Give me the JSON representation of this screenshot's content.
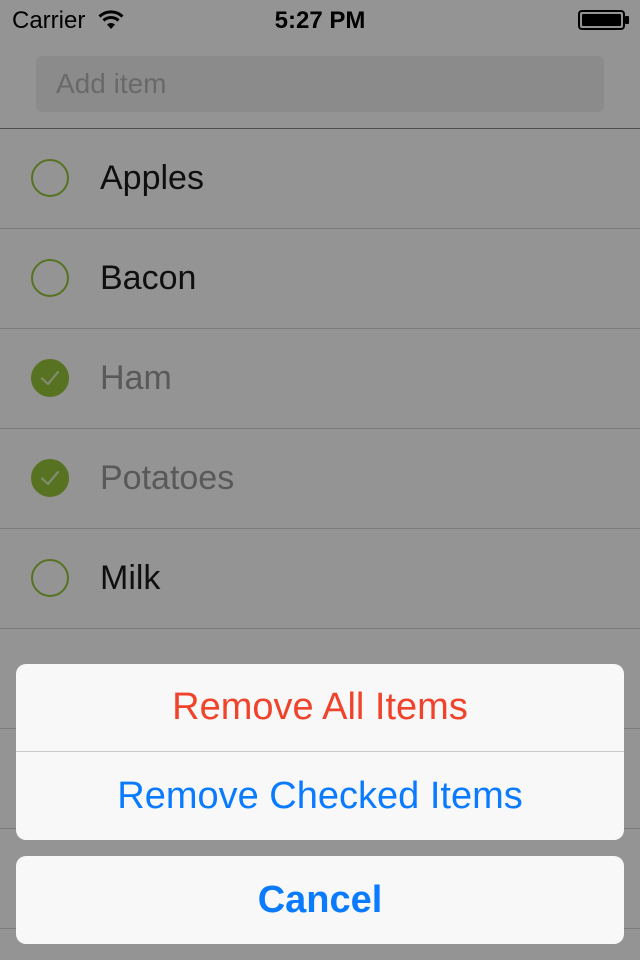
{
  "status_bar": {
    "carrier": "Carrier",
    "time": "5:27 PM",
    "wifi_icon": "wifi-icon",
    "battery_icon": "battery-icon"
  },
  "add_item": {
    "placeholder": "Add item"
  },
  "list": {
    "items": [
      {
        "label": "Apples",
        "checked": false
      },
      {
        "label": "Bacon",
        "checked": false
      },
      {
        "label": "Ham",
        "checked": true
      },
      {
        "label": "Potatoes",
        "checked": true
      },
      {
        "label": "Milk",
        "checked": false
      }
    ]
  },
  "action_sheet": {
    "remove_all": "Remove All Items",
    "remove_checked": "Remove Checked Items",
    "cancel": "Cancel"
  },
  "colors": {
    "accent_green": "#96c43a",
    "action_blue": "#0a7bff",
    "destructive_red": "#f0432c"
  }
}
